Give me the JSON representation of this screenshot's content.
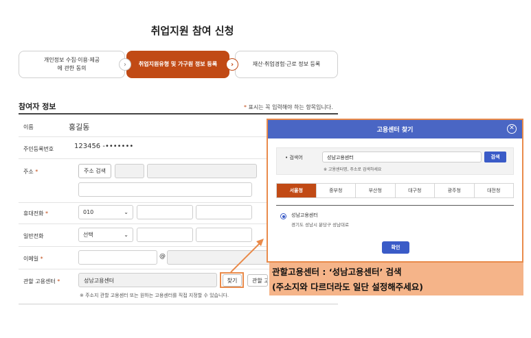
{
  "page": {
    "title": "취업지원 참여 신청"
  },
  "steps": [
    {
      "line1": "개인정보 수집·이용·제공",
      "line2": "에 관한 동의"
    },
    {
      "line1": "취업지원유형 및 가구원 정보 등록",
      "line2": ""
    },
    {
      "line1": "재산·취업경험·근로 정보 등록",
      "line2": ""
    }
  ],
  "form": {
    "section_title": "참여자 정보",
    "required_star": "*",
    "required_note": "표시는 꼭 입력해야 하는 항목입니다.",
    "name": {
      "label": "이름",
      "value": "홍길동"
    },
    "rrn": {
      "label": "주민등록번호",
      "value": "123456 -•••••••"
    },
    "address": {
      "label": "주소",
      "search_button": "주소 검색"
    },
    "mobile": {
      "label": "휴대전화",
      "prefix": "010"
    },
    "phone": {
      "label": "일반전화",
      "prefix": "선택"
    },
    "email": {
      "label": "이메일",
      "at": "@"
    },
    "center": {
      "label": "관할 고용센터",
      "value": "성남고용센터",
      "find_button": "찾기",
      "partial_button": "관할 고용센터",
      "hint": "※ 주소지 관할 고용센터 또는 원하는 고용센터를 직접 지정할 수 있습니다."
    }
  },
  "modal": {
    "title": "고용센터 찾기",
    "search_label": "• 검색어",
    "search_value": "성남고용센터",
    "search_button": "검색",
    "search_hint": "※ 고용센터명, 주소로 검색하세요",
    "tabs": [
      "서울청",
      "중부청",
      "부산청",
      "대구청",
      "광주청",
      "대전청"
    ],
    "result": {
      "name": "성남고용센터",
      "address": "경기도 성남시 분당구 성남대로"
    },
    "confirm_button": "확인"
  },
  "annotation": {
    "line1": "관할고용센터 : ‘성남고용센터’ 검색",
    "line2": "(주소지와 다르더라도 일단 설정해주세요)"
  },
  "colors": {
    "accent": "#c14a15",
    "modal_header": "#4a66c4",
    "annotation_bg": "#f5b489",
    "highlight": "#e98a4a"
  }
}
